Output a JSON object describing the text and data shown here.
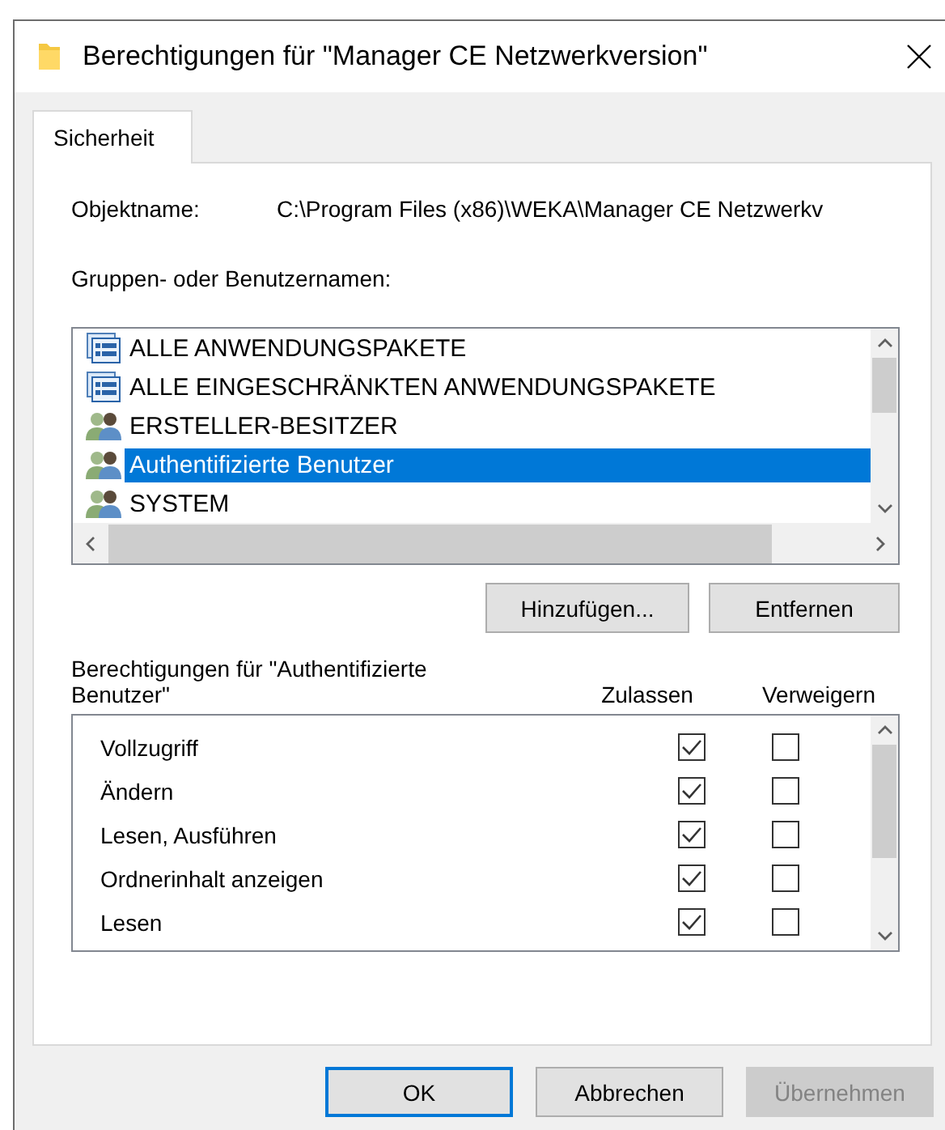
{
  "window": {
    "title": "Berechtigungen für \"Manager CE Netzwerkversion\""
  },
  "tabs": [
    {
      "label": "Sicherheit",
      "selected": true
    }
  ],
  "object_name": {
    "label": "Objektname:",
    "value": "C:\\Program Files (x86)\\WEKA\\Manager CE Netzwerkv"
  },
  "groups": {
    "label": "Gruppen- oder Benutzernamen:",
    "items": [
      {
        "name": "ALLE ANWENDUNGSPAKETE",
        "kind": "package",
        "selected": false
      },
      {
        "name": "ALLE EINGESCHRÄNKTEN ANWENDUNGSPAKETE",
        "kind": "package",
        "selected": false
      },
      {
        "name": "ERSTELLER-BESITZER",
        "kind": "users",
        "selected": false
      },
      {
        "name": "Authentifizierte Benutzer",
        "kind": "users",
        "selected": true
      },
      {
        "name": "SYSTEM",
        "kind": "users",
        "selected": false
      }
    ],
    "buttons": [
      "Hinzufügen...",
      "Entfernen"
    ]
  },
  "permissions": {
    "label": "Berechtigungen für \"Authentifizierte Benutzer\"",
    "columns": [
      "Zulassen",
      "Verweigern"
    ],
    "rows": [
      {
        "name": "Vollzugriff",
        "allow": true,
        "deny": false
      },
      {
        "name": "Ändern",
        "allow": true,
        "deny": false
      },
      {
        "name": "Lesen, Ausführen",
        "allow": true,
        "deny": false
      },
      {
        "name": "Ordnerinhalt anzeigen",
        "allow": true,
        "deny": false
      },
      {
        "name": "Lesen",
        "allow": true,
        "deny": false
      }
    ]
  },
  "footer": [
    {
      "label": "OK",
      "kind": "default",
      "disabled": false
    },
    {
      "label": "Abbrechen",
      "kind": "normal",
      "disabled": false
    },
    {
      "label": "Übernehmen",
      "kind": "normal",
      "disabled": true
    }
  ]
}
